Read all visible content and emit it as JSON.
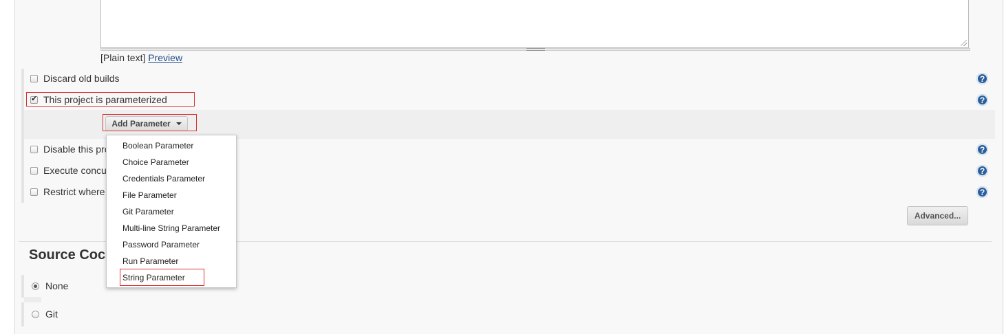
{
  "description": {
    "plain_text_label": "[Plain text]",
    "preview_link": "Preview"
  },
  "options": {
    "discard_old_builds": "Discard old builds",
    "parameterized": "This project is parameterized",
    "disable_project": "Disable this pro",
    "execute_concurrent": "Execute concu",
    "restrict_where": "Restrict where",
    "parameterized_checked": true
  },
  "add_parameter": {
    "label": "Add Parameter",
    "menu": [
      "Boolean Parameter",
      "Choice Parameter",
      "Credentials Parameter",
      "File Parameter",
      "Git Parameter",
      "Multi-line String Parameter",
      "Password Parameter",
      "Run Parameter",
      "String Parameter"
    ],
    "highlighted_item": "String Parameter"
  },
  "advanced_label": "Advanced...",
  "scm": {
    "heading": "Source Coc",
    "options": [
      "None",
      "Git"
    ],
    "selected": "None"
  },
  "help_glyph": "?",
  "colors": {
    "highlight": "#d9302c",
    "link": "#204a87",
    "help_icon": "#2a5e9c"
  }
}
